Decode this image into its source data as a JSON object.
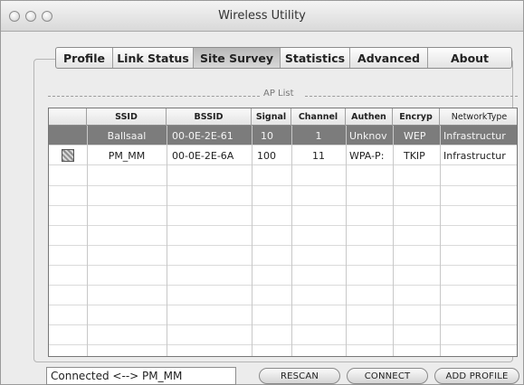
{
  "window": {
    "title": "Wireless Utility"
  },
  "tabs": [
    {
      "label": "Profile",
      "active": false
    },
    {
      "label": "Link Status",
      "active": false
    },
    {
      "label": "Site Survey",
      "active": true
    },
    {
      "label": "Statistics",
      "active": false
    },
    {
      "label": "Advanced",
      "active": false
    },
    {
      "label": "About",
      "active": false
    }
  ],
  "ap_list": {
    "group_label": "AP List",
    "columns": [
      "",
      "SSID",
      "BSSID",
      "Signal",
      "Channel",
      "Authen",
      "Encryp",
      "NetworkType"
    ],
    "rows": [
      {
        "icon": "",
        "ssid": "Ballsaal",
        "bssid": "00-0E-2E-61",
        "signal": "10",
        "channel": "1",
        "authen": "Unknov",
        "encryp": "WEP",
        "network_type": "Infrastructur",
        "selected": true
      },
      {
        "icon": "signal-icon",
        "ssid": "PM_MM",
        "bssid": "00-0E-2E-6A",
        "signal": "100",
        "channel": "11",
        "authen": "WPA-P:",
        "encryp": "TKIP",
        "network_type": "Infrastructur",
        "selected": false
      }
    ]
  },
  "status": {
    "text": "Connected <--> PM_MM"
  },
  "buttons": {
    "rescan": "RESCAN",
    "connect": "CONNECT",
    "add_profile": "ADD PROFILE"
  },
  "colors": {
    "selected_row": "#7c7c7c",
    "window_bg": "#ececec"
  }
}
